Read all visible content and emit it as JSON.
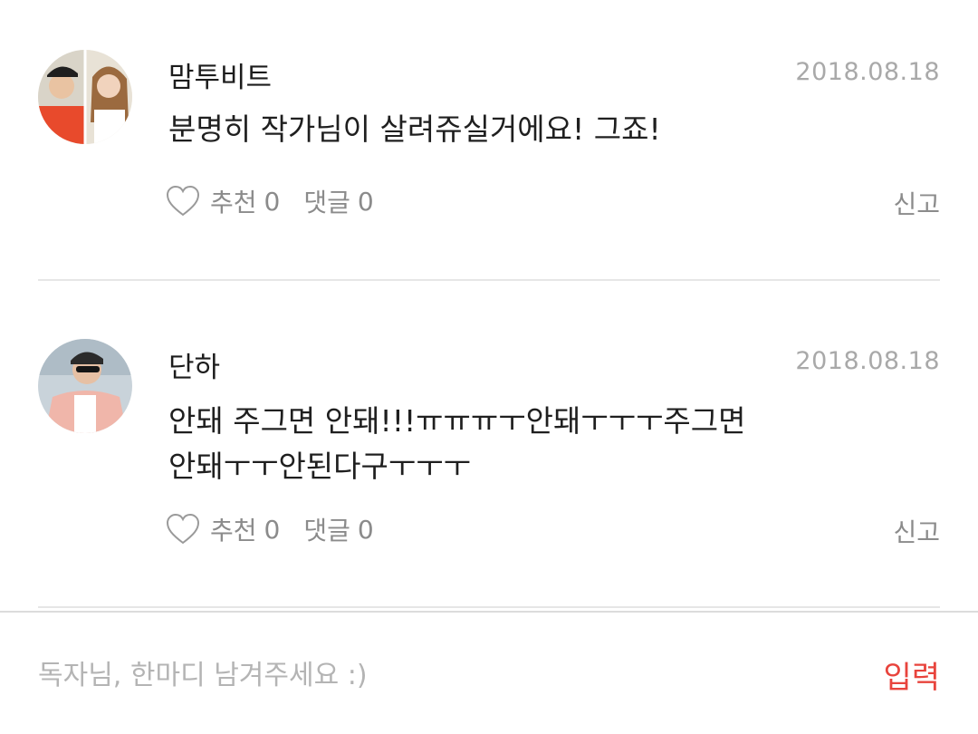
{
  "comments": [
    {
      "author": "맘투비트",
      "date": "2018.08.18",
      "text": "분명히 작가님이 살려쥬실거에요! 그죠!",
      "like_label": "추천",
      "like_count": "0",
      "reply_label": "댓글",
      "reply_count": "0",
      "report_label": "신고"
    },
    {
      "author": "단하",
      "date": "2018.08.18",
      "text_line1": "안돼 주그면 안돼!!!ㅠㅠㅠㅜ안돼ㅜㅜㅜ주그면",
      "text_line2": "안돼ㅜㅜ안된다구ㅜㅜㅜ",
      "like_label": "추천",
      "like_count": "0",
      "reply_label": "댓글",
      "reply_count": "0",
      "report_label": "신고"
    }
  ],
  "input": {
    "placeholder": "독자님, 한마디 남겨주세요 :)",
    "submit_label": "입력"
  },
  "colors": {
    "accent": "#e8443d",
    "muted": "#8b8b8b",
    "date": "#a9a9a9",
    "divider": "#e6e6e6"
  },
  "icons": [
    "heart-outline-icon"
  ]
}
